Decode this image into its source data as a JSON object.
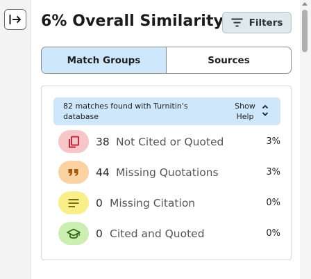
{
  "header": {
    "title": "6% Overall Similarity",
    "filters_label": "Filters"
  },
  "tabs": [
    {
      "label": "Match Groups",
      "active": true
    },
    {
      "label": "Sources",
      "active": false
    }
  ],
  "banner": {
    "text": "82 matches found with Turnitin's database",
    "show_help": "Show Help"
  },
  "groups": [
    {
      "count": "38",
      "label": "Not Cited or Quoted",
      "percent": "3%",
      "icon": "copy-icon",
      "badge_color": "#f7c6c8",
      "icon_color": "#c0283a"
    },
    {
      "count": "44",
      "label": "Missing Quotations",
      "percent": "3%",
      "icon": "quote-icon",
      "badge_color": "#fbd2a2",
      "icon_color": "#a5560f"
    },
    {
      "count": "0",
      "label": "Missing Citation",
      "percent": "0%",
      "icon": "lines-icon",
      "badge_color": "#f8ef8a",
      "icon_color": "#6f6200"
    },
    {
      "count": "0",
      "label": "Cited and Quoted",
      "percent": "0%",
      "icon": "graduation-cap-icon",
      "badge_color": "#cdeeb3",
      "icon_color": "#2f6a14"
    }
  ],
  "colors": {
    "accent_blue": "#cfe7fb",
    "filters_bg": "#dfe8ea"
  }
}
